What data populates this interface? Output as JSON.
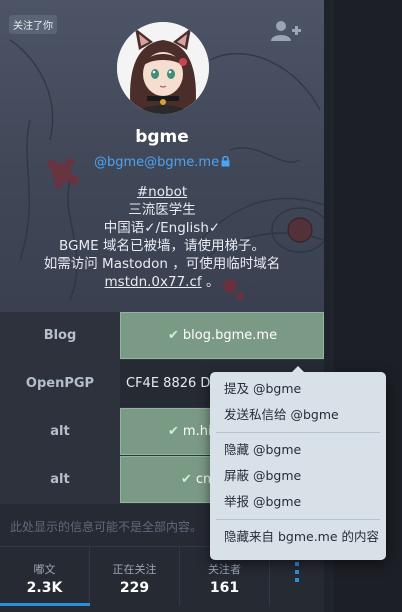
{
  "profile": {
    "follows_you": "关注了你",
    "display_name": "bgme",
    "acct": "@bgme@bgme.me",
    "bio": {
      "line1": "#nobot",
      "line2": "三流医学生",
      "line3": "中国语✓/English✓",
      "line4": "BGME 域名已被墙，请使用梯子。",
      "line5": "如需访问 Mastodon ，可使用临时域名",
      "line6_link": "mstdn.0x77.cf",
      "line6_tail": "。"
    }
  },
  "fields": [
    {
      "name": "Blog",
      "value": "blog.bgme.me",
      "verified": true
    },
    {
      "name": "OpenPGP",
      "value": "CF4E 8826 DA",
      "verified": false
    },
    {
      "name": "alt",
      "value": "m.hitorin",
      "verified": true
    },
    {
      "name": "alt",
      "value": "cmx.",
      "verified": true
    }
  ],
  "notice": "此处显示的信息可能不是全部内容。",
  "stats": [
    {
      "label": "嘟文",
      "value": "2.3K",
      "active": true
    },
    {
      "label": "正在关注",
      "value": "229",
      "active": false
    },
    {
      "label": "关注者",
      "value": "161",
      "active": false
    }
  ],
  "menu": {
    "mention": "提及 @bgme",
    "direct": "发送私信给 @bgme",
    "hide": "隐藏 @bgme",
    "block": "屏蔽 @bgme",
    "report": "举报 @bgme",
    "block_domain": "隐藏来自 bgme.me 的内容"
  },
  "colors": {
    "accent": "#2b90d9",
    "verified_bg": "#7a9a85",
    "menu_bg": "#d9e1e8"
  },
  "icons": [
    "add-friend-icon",
    "lock-icon",
    "check-icon",
    "more-vertical-icon"
  ]
}
